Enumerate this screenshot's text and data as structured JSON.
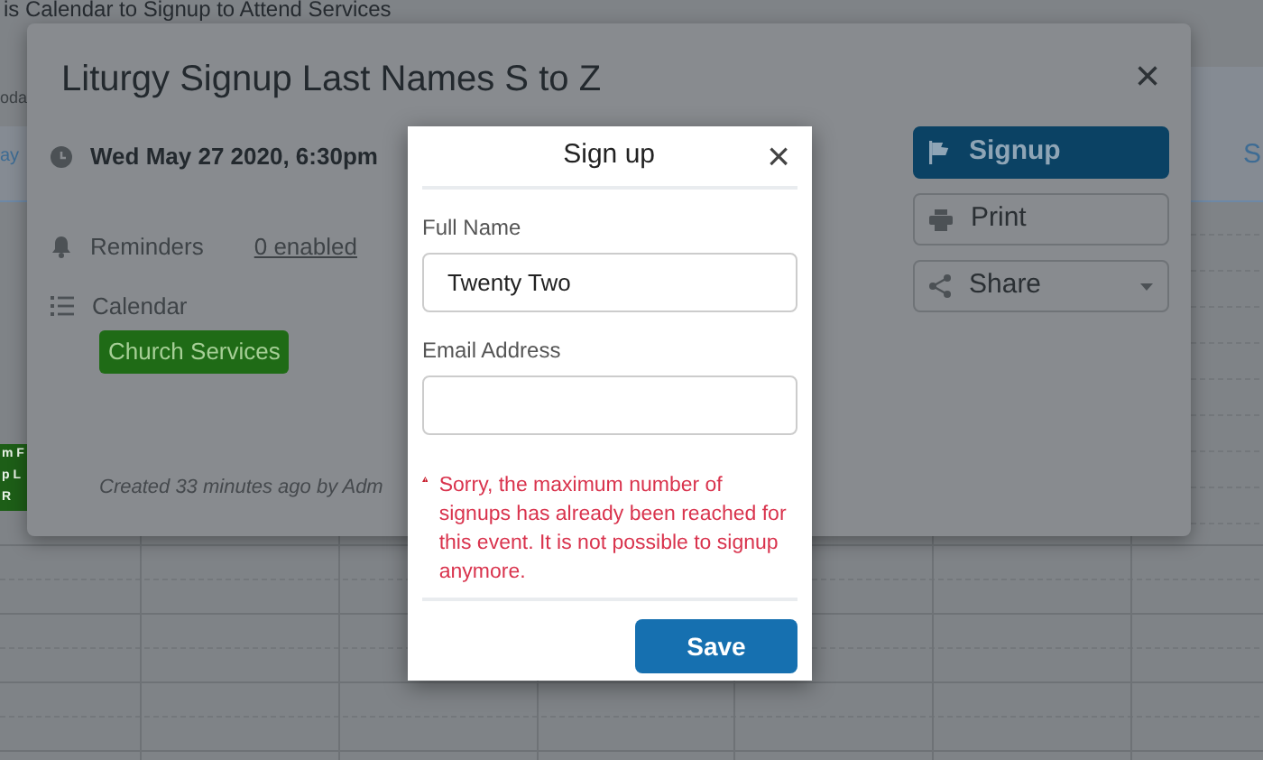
{
  "background_page": {
    "title": "is Calendar to Signup to Attend Services",
    "left_column": [
      "oda",
      "ay"
    ],
    "right_column": [
      "S"
    ],
    "event_chip": [
      "m F",
      "p L",
      "R"
    ]
  },
  "event_modal": {
    "title": "Liturgy Signup Last Names S to Z",
    "close": "×",
    "date": "Wed May 27 2020, 6:30pm",
    "reminders": {
      "label": "Reminders",
      "value": "0 enabled"
    },
    "calendar": {
      "label": "Calendar",
      "tag": "Church Services"
    },
    "created": "Created 33 minutes ago by Adm",
    "actions": [
      {
        "kind": "signup",
        "label": "Signup"
      },
      {
        "kind": "print",
        "label": "Print"
      },
      {
        "kind": "share",
        "label": "Share"
      }
    ]
  },
  "signup_dialog": {
    "title": "Sign up",
    "close": "×",
    "fields": [
      {
        "label": "Full Name",
        "value": "Twenty Two"
      },
      {
        "label": "Email Address"
      }
    ],
    "error": "Sorry, the maximum number of signups has already been reached for this event. It is not possible to signup anymore.",
    "submit": "Save"
  }
}
